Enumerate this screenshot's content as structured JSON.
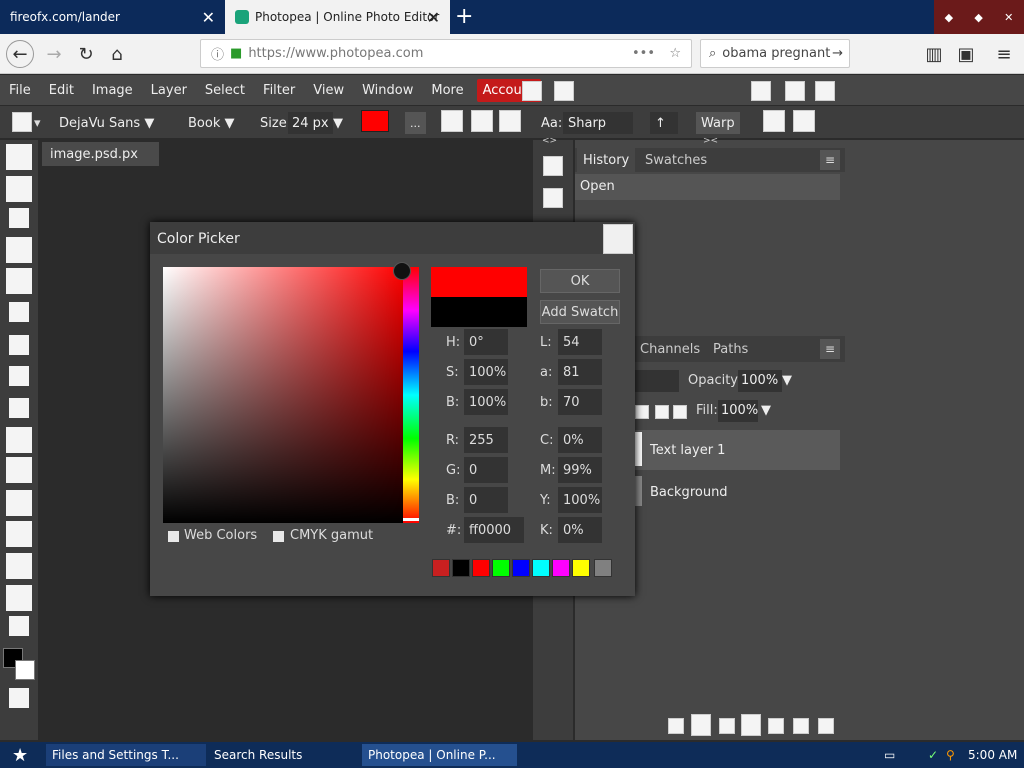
{
  "browser": {
    "tabs": [
      {
        "label": "fireofx.com/lander"
      },
      {
        "label": "Photopea | Online Photo Editor"
      }
    ],
    "url": "https://www.photopea.com",
    "search_text": "obama pregnant",
    "url_menu": "•••"
  },
  "menubar": {
    "items": [
      "File",
      "Edit",
      "Image",
      "Layer",
      "Select",
      "Filter",
      "View",
      "Window",
      "More"
    ],
    "account": "Account"
  },
  "options": {
    "font": "DejaVu Sans",
    "style": "Book",
    "size_label": "Size:",
    "size_value": "24 px",
    "more": "...",
    "aa_label": "Aa:",
    "aa_value": "Sharp",
    "warp": "Warp",
    "color": "#ff0000"
  },
  "document": {
    "tab": "image.psd.px"
  },
  "panels": {
    "history_tab": "History",
    "swatches_tab": "Swatches",
    "history_items": [
      "Open"
    ],
    "channels_tab": "Channels",
    "paths_tab": "Paths",
    "opacity_label": "Opacity:",
    "opacity_value": "100%",
    "fill_label": "Fill:",
    "fill_value": "100%",
    "layers": [
      "Text layer 1",
      "Background"
    ]
  },
  "color_picker": {
    "title": "Color Picker",
    "ok": "OK",
    "add_swatch": "Add Swatch",
    "web_colors": "Web Colors",
    "cmyk_gamut": "CMYK gamut",
    "fields_left": [
      {
        "label": "H:",
        "value": "0°"
      },
      {
        "label": "S:",
        "value": "100%"
      },
      {
        "label": "B:",
        "value": "100%"
      },
      {
        "label": "R:",
        "value": "255"
      },
      {
        "label": "G:",
        "value": "0"
      },
      {
        "label": "B:",
        "value": "0"
      },
      {
        "label": "#:",
        "value": "ff0000"
      }
    ],
    "fields_right": [
      {
        "label": "L:",
        "value": "54"
      },
      {
        "label": "a:",
        "value": "81"
      },
      {
        "label": "b:",
        "value": "70"
      },
      {
        "label": "C:",
        "value": "0%"
      },
      {
        "label": "M:",
        "value": "99%"
      },
      {
        "label": "Y:",
        "value": "100%"
      },
      {
        "label": "K:",
        "value": "0%"
      }
    ],
    "new_color": "#ff0000",
    "old_color": "#000000",
    "swatches": [
      "#c82020",
      "#000000",
      "#ff0000",
      "#00ff00",
      "#0000ff",
      "#00ffff",
      "#ff00ff",
      "#ffff00",
      "#808080"
    ]
  },
  "taskbar": {
    "tasks": [
      "Files and Settings T...",
      "Search Results",
      "Photopea | Online P..."
    ],
    "time": "5:00 AM"
  }
}
